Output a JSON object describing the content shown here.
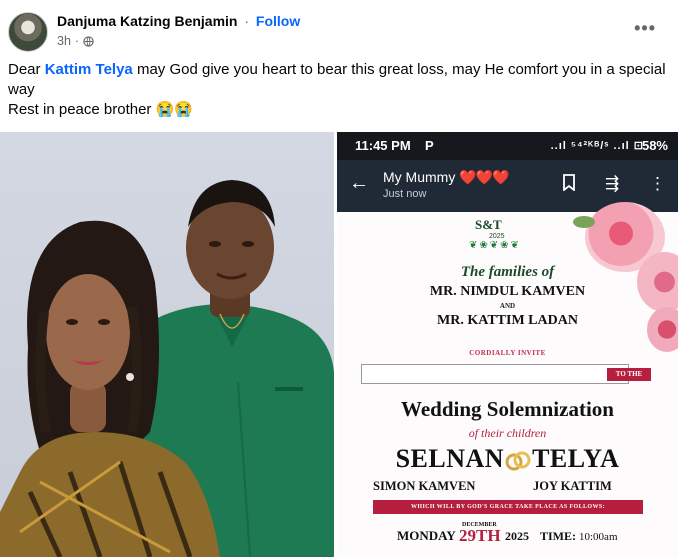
{
  "post": {
    "author": "Danjuma Katzing Benjamin",
    "separator": "·",
    "follow_label": "Follow",
    "time_ago": "3h",
    "more_label": "•••",
    "text_prefix": "Dear ",
    "mention": "Kattim Telya",
    "text_rest": " may God give you heart to bear this great loss, may He comfort you in a special way",
    "text_line2": "Rest in peace brother 😭😭"
  },
  "phone": {
    "time": "11:45 PM",
    "status_p": "P",
    "signal": "..ıl ⁵⁴²ᴷᴮ/ˢ ..ıl ⊡",
    "battery": "58%",
    "chat_title": "My Mummy",
    "chat_hearts": "❤️❤️❤️",
    "chat_subtitle": "Just now"
  },
  "invitation": {
    "logo": "S&T",
    "year": "2025",
    "families": "The families of",
    "family1": "MR. NIMDUL KAMVEN",
    "and": "AND",
    "family2": "MR. KATTIM LADAN",
    "cordially": "CORDIALLY INVITE",
    "to_the": "TO THE",
    "wedding": "Wedding Solemnization",
    "their_children": "of their children",
    "groom": "SELNAN",
    "bride": "TELYA",
    "groom_full": "SIMON KAMVEN",
    "bride_full": "JOY KATTIM",
    "ribbon": "WHICH WILL BY GOD'S GRACE TAKE PLACE AS FOLLOWS:",
    "day": "MONDAY",
    "month": "DECEMBER",
    "date": "29TH",
    "year_short": "2025",
    "time_label": "TIME:",
    "time_value": "10:00am"
  },
  "colors": {
    "link_blue": "#0866ff",
    "meta_gray": "#65676b",
    "invite_red": "#b61e3f",
    "invite_green": "#1b4a2a"
  }
}
